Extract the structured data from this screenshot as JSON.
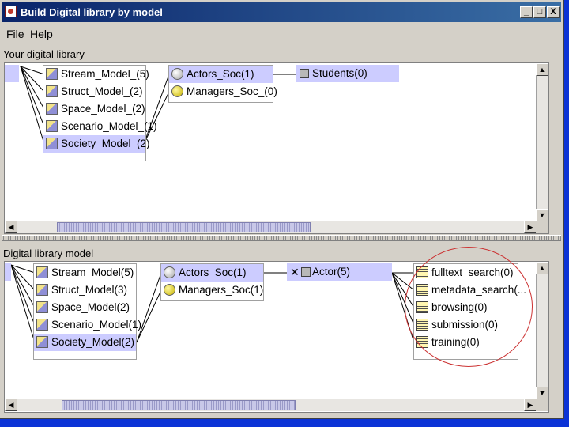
{
  "window": {
    "title": "Build Digital library by model",
    "controls": [
      "_",
      "□",
      "X"
    ]
  },
  "menu": {
    "file": "File",
    "help": "Help"
  },
  "top": {
    "label": "Your digital library",
    "models": [
      {
        "label": "Stream_Model_(5)",
        "selected": false
      },
      {
        "label": "Struct_Model_(2)",
        "selected": false
      },
      {
        "label": "Space_Model_(2)",
        "selected": false
      },
      {
        "label": "Scenario_Model_(1)",
        "selected": false
      },
      {
        "label": "Society_Model_(2)",
        "selected": true
      }
    ],
    "society": [
      {
        "label": "Actors_Soc(1)",
        "icon": "silver-ball-icon",
        "selected": true
      },
      {
        "label": "Managers_Soc_(0)",
        "icon": "gold-ball-icon",
        "selected": false
      }
    ],
    "actor_node": {
      "label": "Students(0)"
    }
  },
  "bottom": {
    "label": "Digital library model",
    "models": [
      {
        "label": "Stream_Model(5)",
        "selected": false
      },
      {
        "label": "Struct_Model(3)",
        "selected": false
      },
      {
        "label": "Space_Model(2)",
        "selected": false
      },
      {
        "label": "Scenario_Model(1)",
        "selected": false
      },
      {
        "label": "Society_Model(2)",
        "selected": true
      }
    ],
    "society": [
      {
        "label": "Actors_Soc(1)",
        "icon": "silver-ball-icon",
        "selected": true
      },
      {
        "label": "Managers_Soc(1)",
        "icon": "gold-ball-icon",
        "selected": false
      }
    ],
    "actor_node": {
      "label": "Actor(5)"
    },
    "services": [
      {
        "label": "fulltext_search(0)"
      },
      {
        "label": "metadata_search(..."
      },
      {
        "label": "browsing(0)"
      },
      {
        "label": "submission(0)"
      },
      {
        "label": "training(0)"
      }
    ]
  },
  "colors": {
    "selection": "#ccccff",
    "titlebar": "#0a246a",
    "annotation_circle": "#cc3333",
    "desktop": "#0b33d6"
  }
}
